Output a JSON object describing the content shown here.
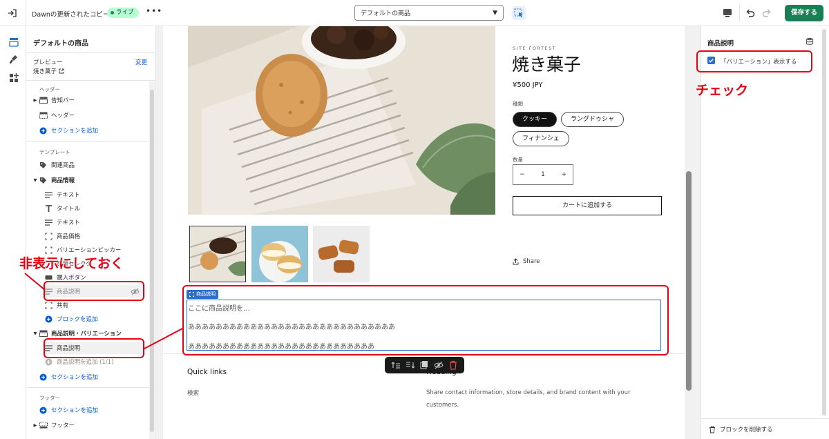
{
  "topbar": {
    "theme_name": "Dawnの更新されたコピー",
    "live_badge": "ライブ",
    "more": "•••",
    "template_select": "デフォルトの商品",
    "save_label": "保存する"
  },
  "sidebar": {
    "title": "デフォルトの商品",
    "preview_label": "プレビュー",
    "preview_change": "変更",
    "preview_value": "焼き菓子",
    "header_group_label": "ヘッダー",
    "template_group_label": "テンプレート",
    "footer_group_label": "フッター",
    "header_items": [
      "告知バー",
      "ヘッダー"
    ],
    "add_section": "セクションを追加",
    "related_products": "関連商品",
    "product_info": "商品情報",
    "product_info_blocks": [
      "テキスト",
      "タイトル",
      "テキスト",
      "商品価格",
      "バリエーションピッカー",
      "数量セレクタ",
      "購入ボタン",
      "商品説明",
      "共有"
    ],
    "add_block": "ブロックを追加",
    "desc_section": "商品説明・バリエーション",
    "desc_section_block": "商品説明",
    "desc_section_add": "商品説明を追加 (1/1)",
    "footer_item": "フッター"
  },
  "product": {
    "vendor": "SITE FORTEST",
    "title": "焼き菓子",
    "price": "¥500 JPY",
    "type_label": "種類",
    "variants": [
      "クッキー",
      "ラングドゥシャ",
      "フィナンシェ"
    ],
    "selected_variant": "クッキー",
    "qty_label": "数量",
    "qty_minus": "−",
    "qty_value": "1",
    "qty_plus": "+",
    "add_to_cart": "カートに追加する",
    "share": "Share"
  },
  "description_block": {
    "tag": "商品説明",
    "lines": [
      "ここに商品説明を…",
      "ああああああああああああああああああああああああああああああ",
      "あああああああああああああああああああああああああああ"
    ]
  },
  "footer": {
    "quick_links_title": "Quick links",
    "quick_link": "検索",
    "newsletter_title_fragment": "Heading",
    "text": "Share contact information, store details, and brand content with your customers."
  },
  "right_panel": {
    "title": "商品説明",
    "checkbox_label": "「バリエーション」表示する",
    "checkbox_checked": true,
    "delete_block": "ブロックを削除する"
  },
  "annotations": {
    "hide_label": "非表示にしておく",
    "check_label": "チェック"
  },
  "colors": {
    "accent": "#1a7f54",
    "link": "#005bd3",
    "selection": "#2c6ecb",
    "annotation": "#e60012"
  }
}
